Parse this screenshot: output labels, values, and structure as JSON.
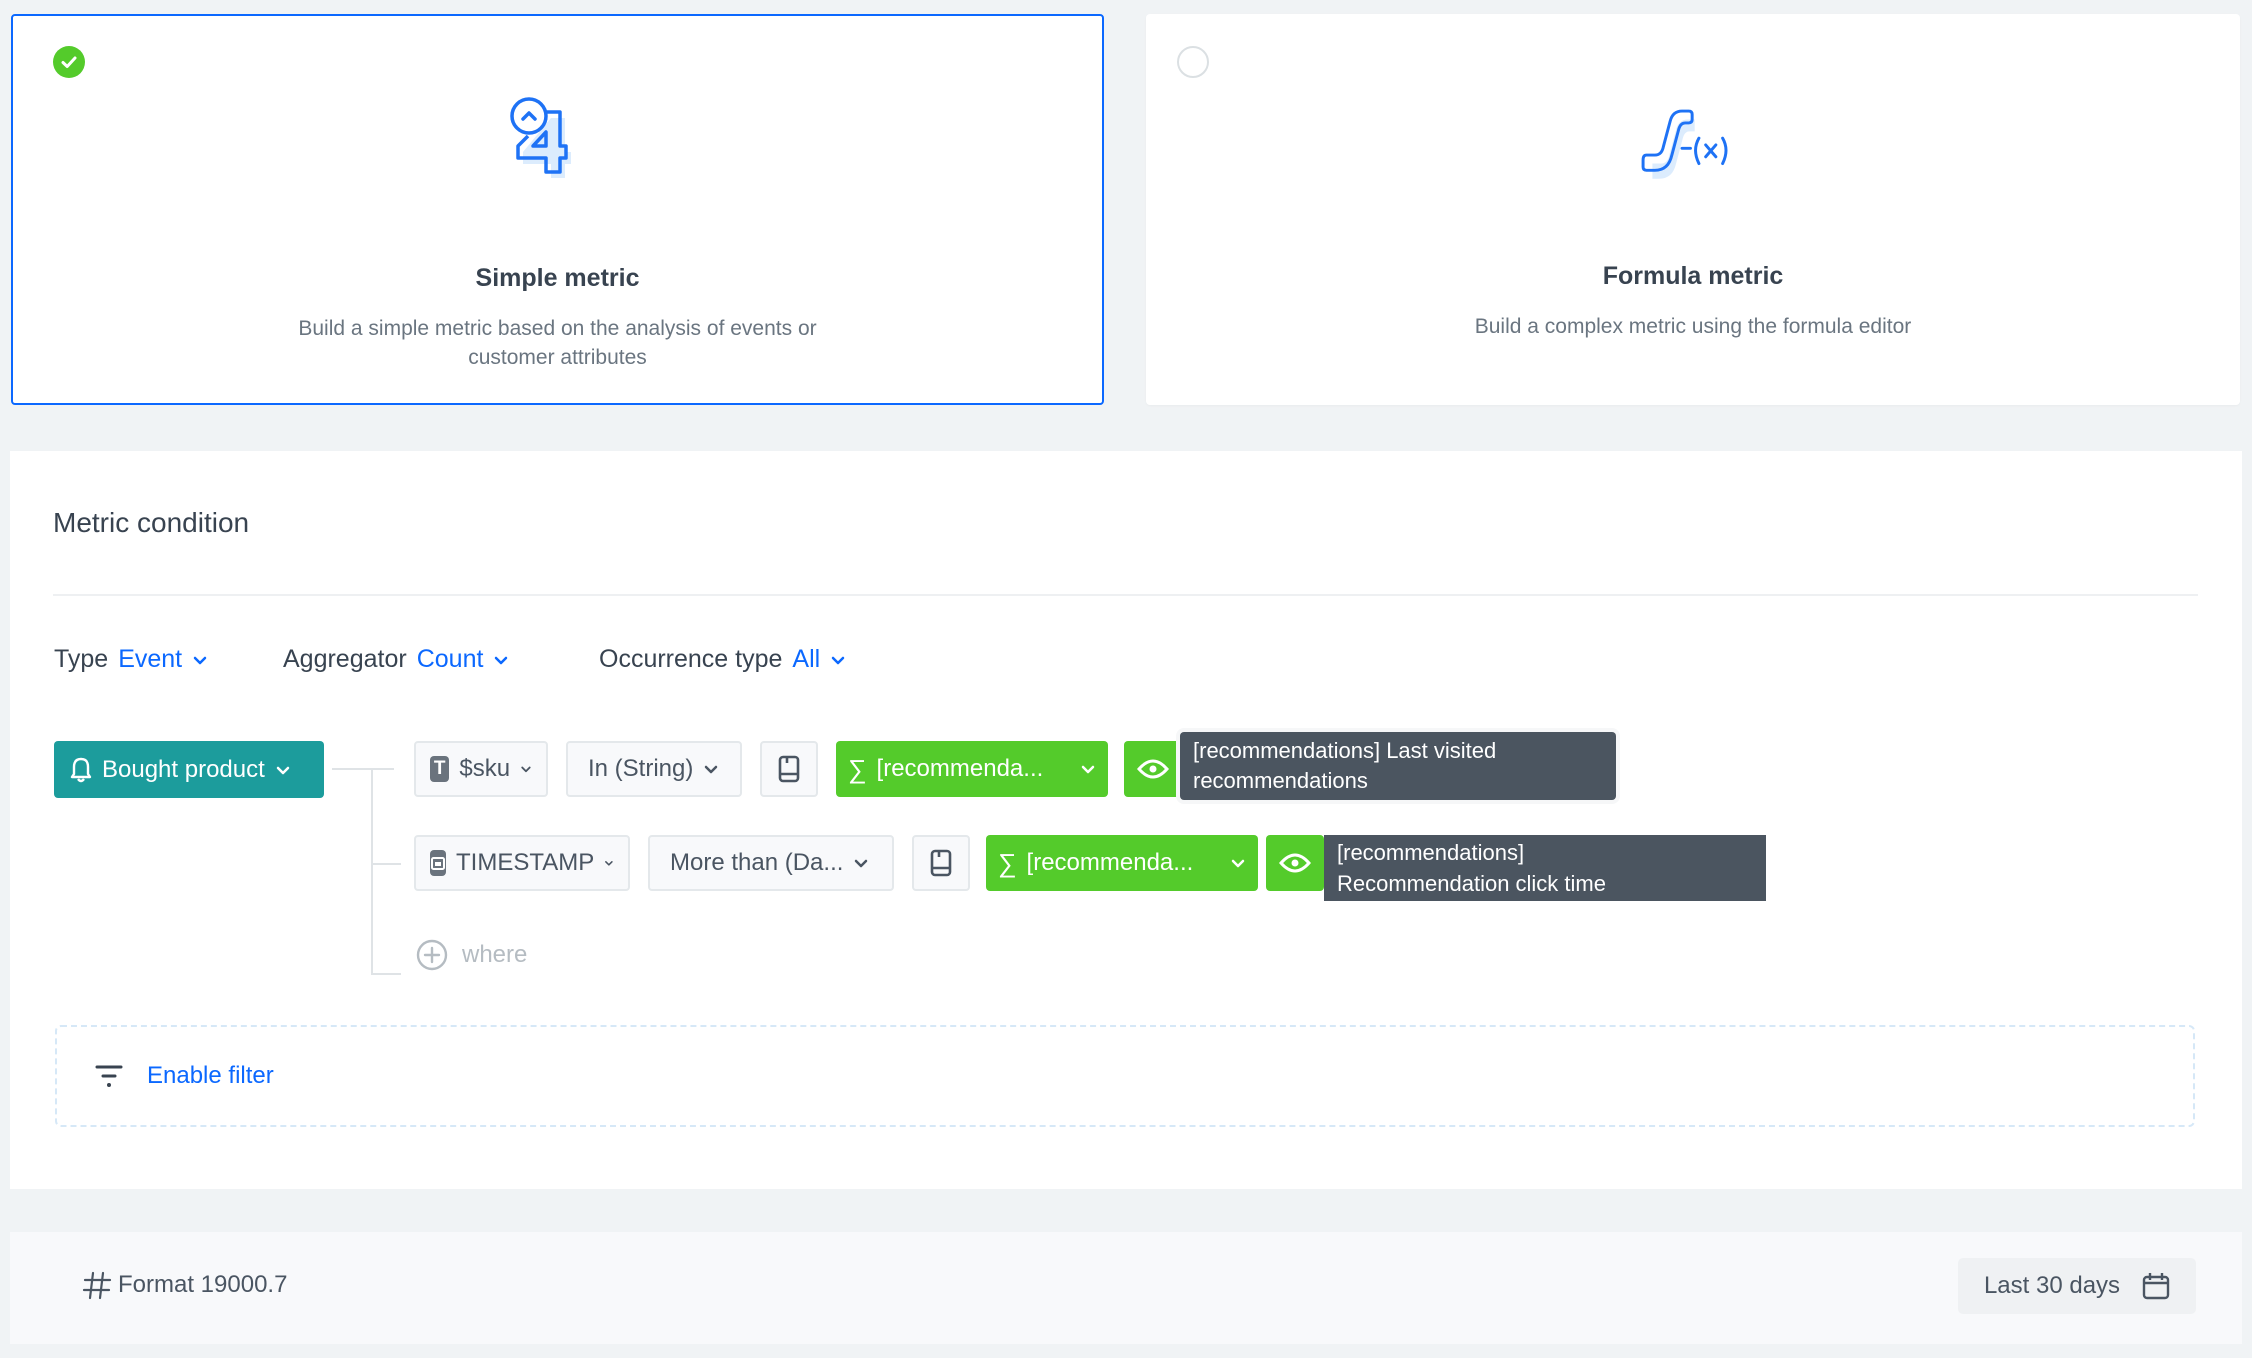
{
  "metric_types": {
    "simple": {
      "title": "Simple metric",
      "description": "Build a simple metric based on the analysis of events or customer attributes",
      "selected": true,
      "icon": "number-four-icon"
    },
    "formula": {
      "title": "Formula metric",
      "description": "Build a complex metric using the formula editor",
      "selected": false,
      "icon": "function-fx-icon"
    }
  },
  "metric_condition": {
    "title": "Metric condition",
    "options": {
      "type": {
        "label": "Type",
        "value": "Event"
      },
      "aggregator": {
        "label": "Aggregator",
        "value": "Count"
      },
      "occurrence": {
        "label": "Occurrence type",
        "value": "All"
      }
    },
    "event": {
      "label": "Bought product",
      "icon": "bell-icon"
    },
    "conditions": [
      {
        "param": "$sku",
        "param_icon": "text-type-icon",
        "operator": "In (String)",
        "value": "[recommenda...",
        "tooltip": "[recommendations] Last visited recommendations"
      },
      {
        "param": "TIMESTAMP",
        "param_icon": "date-type-icon",
        "operator": "More than (Da...",
        "value": "[recommenda...",
        "tooltip_line1": "[recommendations]",
        "tooltip_line2": "Recommendation click time"
      }
    ],
    "add_where": "where",
    "filter_label": "Enable filter"
  },
  "footer": {
    "format_label": "Format 19000.7",
    "date_range": "Last 30 days"
  },
  "colors": {
    "accent": "#0b68ff",
    "success": "#54cb2b",
    "event": "#1c9c9c",
    "tooltip": "#4b5560"
  }
}
